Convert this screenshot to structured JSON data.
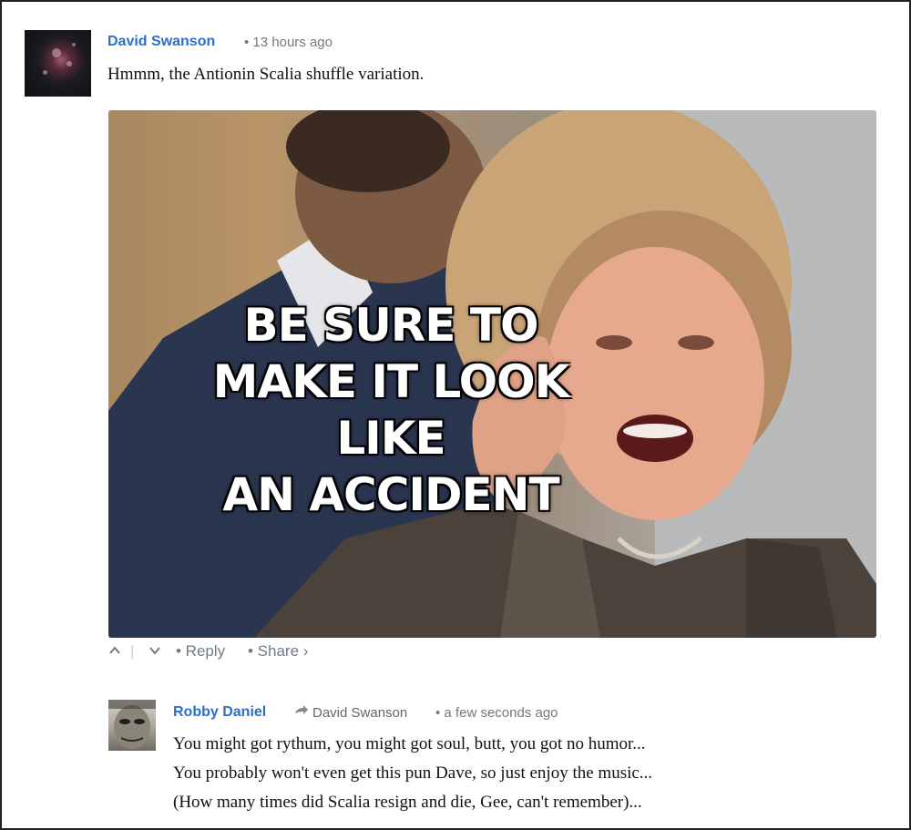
{
  "comment": {
    "author": "David Swanson",
    "meta": "• 13 hours ago",
    "text": "Hmmm, the Antionin Scalia shuffle variation.",
    "image": {
      "caption_lines": [
        "BE SURE TO",
        "MAKE IT LOOK LIKE",
        "AN ACCIDENT"
      ]
    },
    "actions": {
      "upvote_icon": "chevron-up-icon",
      "separator": "|",
      "downvote_icon": "chevron-down-icon",
      "reply_label": "• Reply",
      "share_label": "• Share ›"
    }
  },
  "reply": {
    "author": "Robby Daniel",
    "reply_to_icon": "reply-arrow-icon",
    "reply_to": "David Swanson",
    "meta": "• a few seconds ago",
    "lines": [
      "You might got rythum, you might got soul, butt, you got no humor...",
      "You probably won't even get this pun Dave, so just enjoy the music...",
      "(How many times did Scalia resign and die, Gee, can't remember)..."
    ]
  },
  "colors": {
    "author_link": "#2a6fc9",
    "meta_text": "#777777",
    "action_text": "#6e7b88"
  }
}
